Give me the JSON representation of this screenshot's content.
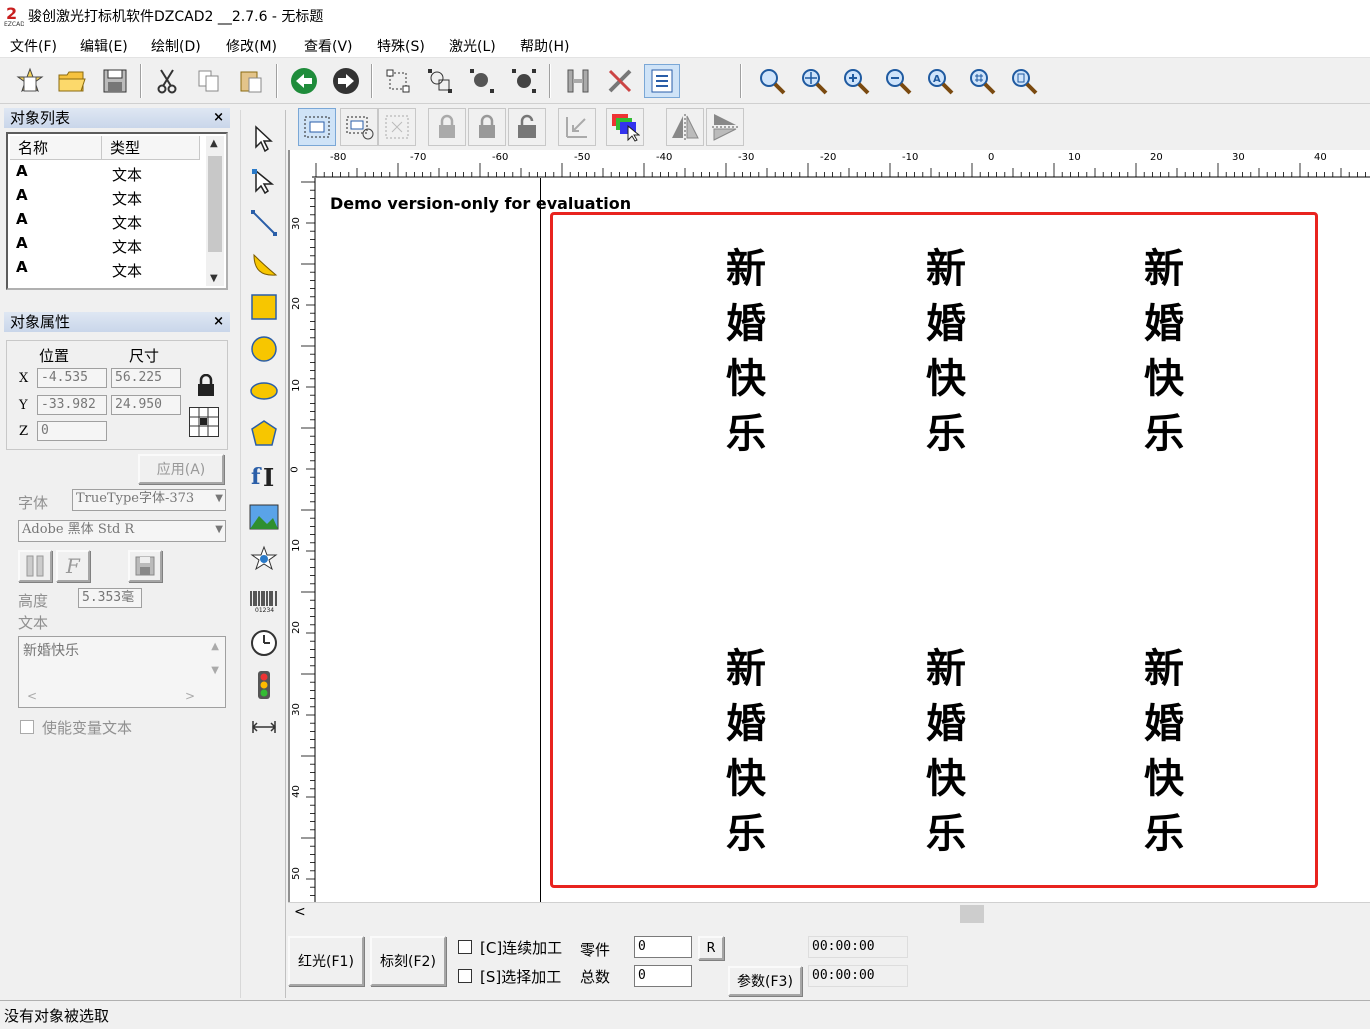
{
  "title": "骏创激光打标机软件DZCAD2 __2.7.6 - 无标题",
  "menu": [
    "文件(F)",
    "编辑(E)",
    "绘制(D)",
    "修改(M)",
    "查看(V)",
    "特殊(S)",
    "激光(L)",
    "帮助(H)"
  ],
  "object_list": {
    "title": "对象列表",
    "col_name": "名称",
    "col_type": "类型",
    "rows": [
      {
        "name": "A",
        "type": "文本"
      },
      {
        "name": "A",
        "type": "文本"
      },
      {
        "name": "A",
        "type": "文本"
      },
      {
        "name": "A",
        "type": "文本"
      },
      {
        "name": "A",
        "type": "文本"
      }
    ]
  },
  "object_props": {
    "title": "对象属性",
    "position_label": "位置",
    "size_label": "尺寸",
    "x_label": "X",
    "y_label": "Y",
    "z_label": "Z",
    "x": "-4.535",
    "y": "-33.982",
    "z": "0",
    "width": "56.225",
    "height": "24.950",
    "apply_label": "应用(A)",
    "font_label": "字体",
    "font_type": "TrueType字体-373",
    "font_name": "Adobe 黑体 Std R",
    "text_height_label": "高度",
    "text_height": "5.353毫",
    "text_label": "文本",
    "text_value": "新婚快乐",
    "variable_text_label": "使能变量文本"
  },
  "canvas": {
    "demo_text": "Demo version-only for evaluation",
    "h_ruler": [
      "-80",
      "-70",
      "-60",
      "-50",
      "-40",
      "-30",
      "-20",
      "-10",
      "0",
      "10",
      "20",
      "30",
      "40"
    ],
    "v_ruler": [
      "30",
      "20",
      "10",
      "0",
      "10",
      "20",
      "30",
      "40",
      "50"
    ],
    "text_blocks": [
      {
        "chars": [
          "新",
          "婚",
          "快",
          "乐"
        ]
      },
      {
        "chars": [
          "新",
          "婚",
          "快",
          "乐"
        ]
      },
      {
        "chars": [
          "新",
          "婚",
          "快",
          "乐"
        ]
      },
      {
        "chars": [
          "新",
          "婚",
          "快",
          "乐"
        ]
      },
      {
        "chars": [
          "新",
          "婚",
          "快",
          "乐"
        ]
      },
      {
        "chars": [
          "新",
          "婚",
          "快",
          "乐"
        ]
      }
    ],
    "highlight_color": "#e8231f"
  },
  "bottom": {
    "red_light": "红光(F1)",
    "mark": "标刻(F2)",
    "continuous": "[C]连续加工",
    "selected": "[S]选择加工",
    "parts_label": "零件",
    "total_label": "总数",
    "parts_value": "0",
    "total_value": "0",
    "r_button": "R",
    "params": "参数(F3)",
    "time1": "00:00:00",
    "time2": "00:00:00"
  },
  "status": "没有对象被选取"
}
